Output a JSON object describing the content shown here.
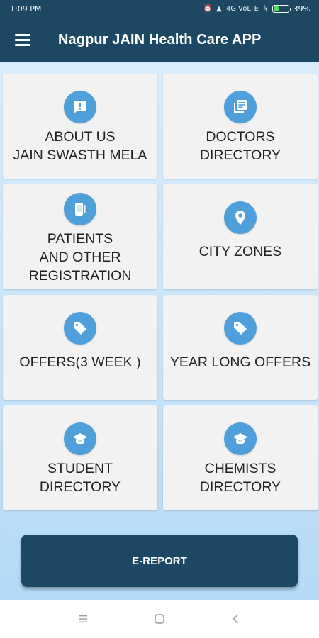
{
  "status_bar": {
    "time": "1:09 PM",
    "network": "4G VoLTE",
    "battery": "39%",
    "battery_level": 0.39
  },
  "app_bar": {
    "title": "Nagpur JAIN Health Care APP",
    "menu_icon": "hamburger-menu-icon"
  },
  "tiles": [
    {
      "icon": "exclamation-chat-icon",
      "lines": [
        "ABOUT US",
        "JAIN SWASTH MELA"
      ]
    },
    {
      "icon": "directory-list-icon",
      "lines": [
        "DOCTORS",
        "DIRECTORY"
      ]
    },
    {
      "icon": "registration-device-icon",
      "lines": [
        "PATIENTS",
        "AND OTHER",
        "REGISTRATION"
      ]
    },
    {
      "icon": "location-pin-icon",
      "lines": [
        "CITY ZONES"
      ]
    },
    {
      "icon": "offer-tag-icon",
      "lines": [
        "OFFERS(3 WEEK )"
      ]
    },
    {
      "icon": "offer-tag-icon",
      "lines": [
        "YEAR LONG OFFERS"
      ]
    },
    {
      "icon": "graduation-cap-icon",
      "lines": [
        "STUDENT",
        "DIRECTORY"
      ]
    },
    {
      "icon": "graduation-cap-icon",
      "lines": [
        "CHEMISTS",
        "DIRECTORY"
      ]
    }
  ],
  "ereport_button": {
    "label": "E-REPORT"
  },
  "colors": {
    "primary": "#1d4863",
    "icon_circle": "#4f9fdb",
    "tile_bg": "#f2f2f2",
    "background": "#c6e3f9"
  },
  "nav_bar": {
    "icons": [
      "recents-menu-icon",
      "home-square-icon",
      "back-chevron-icon"
    ]
  }
}
